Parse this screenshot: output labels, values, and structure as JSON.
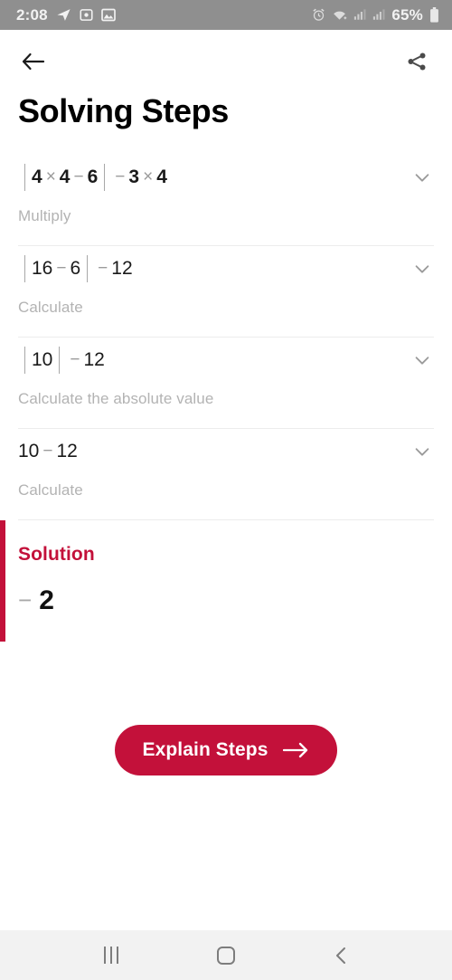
{
  "theme": {
    "accent": "#c3113a",
    "status_bar_bg": "#8f8f8f",
    "nav_bar_bg": "#f2f2f2"
  },
  "status_bar": {
    "time": "2:08",
    "battery_percent": "65%",
    "left_icons": [
      "telegram-icon",
      "camera-icon",
      "photo-icon"
    ],
    "right_icons": [
      "alarm-icon",
      "wifi-icon",
      "signal-icon-1",
      "signal-icon-2",
      "battery-icon"
    ]
  },
  "header": {
    "back_icon": "back-arrow-icon",
    "share_icon": "share-icon",
    "title": "Solving Steps"
  },
  "steps": [
    {
      "expression_parts": [
        {
          "type": "bar",
          "text": "|"
        },
        {
          "type": "num",
          "text": "4"
        },
        {
          "type": "op",
          "text": "×"
        },
        {
          "type": "num",
          "text": "4"
        },
        {
          "type": "op",
          "text": "−"
        },
        {
          "type": "num",
          "text": "6"
        },
        {
          "type": "bar",
          "text": "|"
        },
        {
          "type": "op",
          "text": "−"
        },
        {
          "type": "num",
          "text": "3"
        },
        {
          "type": "op",
          "text": "×"
        },
        {
          "type": "num",
          "text": "4"
        }
      ],
      "expression_text": "|4 × 4 − 6| − 3 × 4",
      "label": "Multiply",
      "bold": true,
      "chevron": "chevron-down-icon"
    },
    {
      "expression_parts": [
        {
          "type": "bar",
          "text": "|"
        },
        {
          "type": "num",
          "text": "16"
        },
        {
          "type": "op",
          "text": "−"
        },
        {
          "type": "num",
          "text": "6"
        },
        {
          "type": "bar",
          "text": "|"
        },
        {
          "type": "op",
          "text": "−"
        },
        {
          "type": "num",
          "text": "12"
        }
      ],
      "expression_text": "|16 − 6| − 12",
      "label": "Calculate",
      "bold": false,
      "chevron": "chevron-down-icon"
    },
    {
      "expression_parts": [
        {
          "type": "bar",
          "text": "|"
        },
        {
          "type": "num",
          "text": "10"
        },
        {
          "type": "bar",
          "text": "|"
        },
        {
          "type": "op",
          "text": "−"
        },
        {
          "type": "num",
          "text": "12"
        }
      ],
      "expression_text": "|10| − 12",
      "label": "Calculate the absolute value",
      "bold": false,
      "chevron": "chevron-down-icon"
    },
    {
      "expression_parts": [
        {
          "type": "num",
          "text": "10"
        },
        {
          "type": "op",
          "text": "−"
        },
        {
          "type": "num",
          "text": "12"
        }
      ],
      "expression_text": "10 − 12",
      "label": "Calculate",
      "bold": false,
      "chevron": "chevron-down-icon"
    }
  ],
  "solution": {
    "title": "Solution",
    "value_sign": "−",
    "value_number": "2",
    "value_text": "− 2"
  },
  "cta": {
    "label": "Explain Steps",
    "icon": "arrow-right-icon"
  },
  "nav_bar": {
    "recents": "recents-icon",
    "home": "home-icon",
    "back": "back-icon"
  }
}
